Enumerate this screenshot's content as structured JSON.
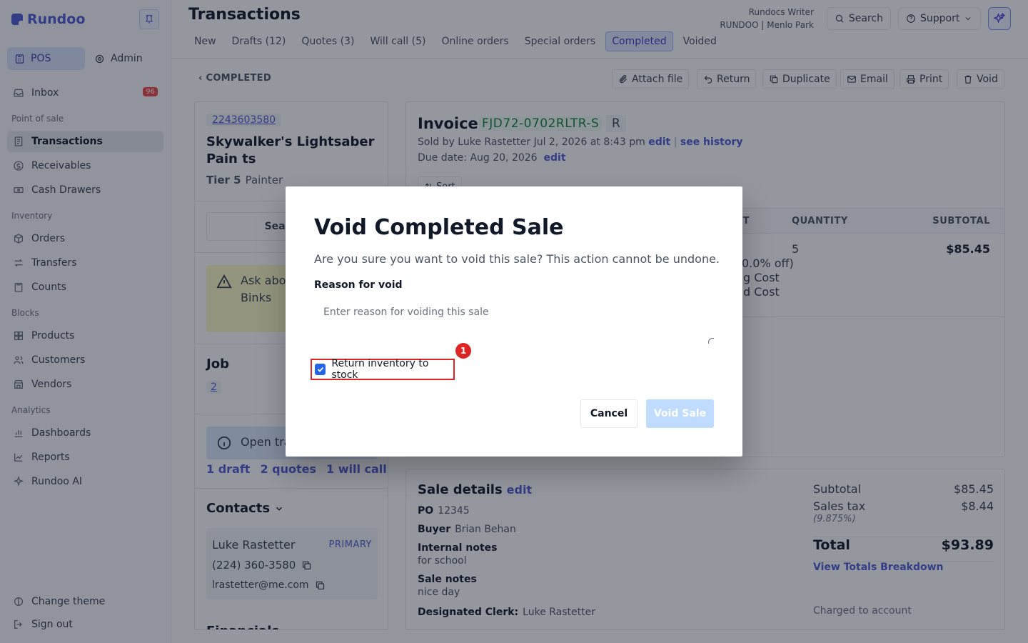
{
  "app": {
    "name": "Rundoo"
  },
  "sidebar": {
    "modes": [
      "POS",
      "Admin"
    ],
    "inbox": {
      "label": "Inbox",
      "count": "96"
    },
    "sections": [
      {
        "title": "Point of sale",
        "items": [
          "Transactions",
          "Receivables",
          "Cash Drawers"
        ]
      },
      {
        "title": "Inventory",
        "items": [
          "Orders",
          "Transfers",
          "Counts"
        ]
      },
      {
        "title": "Blocks",
        "items": [
          "Products",
          "Customers",
          "Vendors"
        ]
      },
      {
        "title": "Analytics",
        "items": [
          "Dashboards",
          "Reports",
          "Rundoo AI"
        ]
      }
    ],
    "footer": [
      "Change theme",
      "Sign out"
    ]
  },
  "header": {
    "title": "Transactions",
    "tabs": [
      "New",
      "Drafts (12)",
      "Quotes (3)",
      "Will call (5)",
      "Online orders",
      "Special orders",
      "Completed",
      "Voided"
    ],
    "active_tab": "Completed",
    "user_name": "Rundocs Writer",
    "store": "RUNDOO | Menlo Park",
    "search_label": "Search",
    "support_label": "Support"
  },
  "actions": {
    "back_label": "COMPLETED",
    "buttons": [
      "Attach file",
      "Return",
      "Duplicate",
      "Email",
      "Print",
      "Void"
    ]
  },
  "customer": {
    "number": "2243603580",
    "name": "Skywalker's Lightsaber Pain ts",
    "tier": "Tier 5",
    "role": "Painter",
    "search_sales": "Search sa",
    "note": "Ask abou think abo Binks",
    "job_label": "Job",
    "job_number": "2",
    "open_label": "Open tra",
    "open_links": [
      "1 draft",
      "2 quotes",
      "1 will call"
    ],
    "contacts_label": "Contacts",
    "contact": {
      "name": "Luke Rastetter",
      "tag": "PRIMARY",
      "phone": "(224) 360-3580",
      "email": "lrastetter@me.com"
    },
    "finance_label": "Financials"
  },
  "invoice": {
    "label": "Invoice",
    "number": "FJD72-0702RLTR-S",
    "type": "R",
    "sold_by": "Sold by Luke Rastetter Jul 2, 2026 at 8:43 pm",
    "edit": "edit",
    "history": "see history",
    "due": "Due date: Aug 20, 2026",
    "sort": "Sort",
    "columns": [
      "OST",
      "QUANTITY",
      "SUBTOTAL"
    ],
    "row": {
      "discount": "0.0% off)",
      "cost1": "g Cost",
      "cost2": "d Cost",
      "qty": "5",
      "subtotal": "$85.45"
    }
  },
  "sale_details": {
    "title": "Sale details",
    "edit": "edit",
    "po_label": "PO",
    "po": "12345",
    "buyer_label": "Buyer",
    "buyer": "Brian Behan",
    "internal_label": "Internal notes",
    "internal": "for school",
    "sale_notes_label": "Sale notes",
    "sale_notes": "nice day",
    "clerk_label": "Designated Clerk:",
    "clerk": "Luke Rastetter",
    "subtotal_label": "Subtotal",
    "subtotal": "$85.45",
    "tax_label": "Sales tax",
    "tax": "$8.44",
    "tax_rate": "(9.875%)",
    "total_label": "Total",
    "total": "$93.89",
    "breakdown": "View Totals Breakdown",
    "charged": "Charged to account"
  },
  "modal": {
    "title": "Void Completed Sale",
    "description": "Are you sure you want to void this sale? This action cannot be undone.",
    "reason_label": "Reason for void",
    "reason_placeholder": "Enter reason for voiding this sale",
    "return_checkbox_label": "Return inventory to stock",
    "return_checked": true,
    "marker": "1",
    "cancel": "Cancel",
    "confirm": "Void Sale"
  },
  "colors": {
    "accent": "#4f5bd5",
    "danger": "#dc2626",
    "confirm_disabled": "#bfdbfe"
  }
}
